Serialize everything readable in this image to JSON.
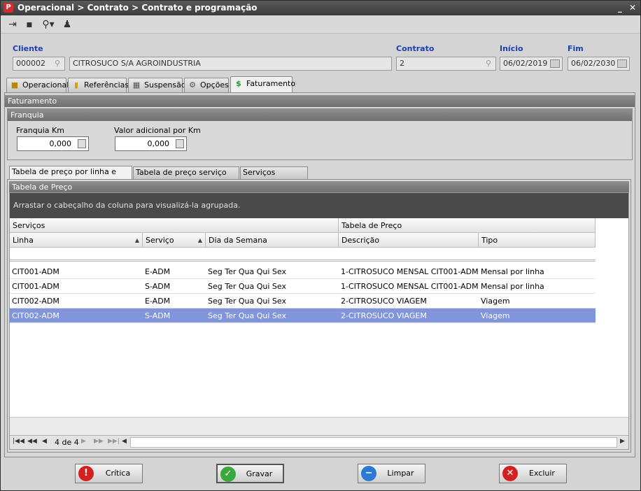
{
  "window": {
    "title": "Operacional > Contrato > Contrato e programação",
    "logo": "logo-icon"
  },
  "header": {
    "cliente_label": "Cliente",
    "cliente_code": "000002",
    "cliente_name": "CITROSUCO S/A AGROINDUSTRIA",
    "contrato_label": "Contrato",
    "contrato_value": "2",
    "inicio_label": "Início",
    "inicio_value": "06/02/2019",
    "fim_label": "Fim",
    "fim_value": "06/02/2030"
  },
  "tabs": [
    {
      "label": "Operacional",
      "icon": "truck-icon"
    },
    {
      "label": "Referências",
      "icon": "bookmark-icon"
    },
    {
      "label": "Suspensão",
      "icon": "calendar-icon"
    },
    {
      "label": "Opções",
      "icon": "gear-icon"
    },
    {
      "label": "Faturamento",
      "icon": "dollar-icon"
    }
  ],
  "faturamento": {
    "title": "Faturamento",
    "franquia_title": "Franquia",
    "franquia_km_label": "Franquia Km",
    "franquia_km_value": "0,000",
    "valor_adicional_label": "Valor adicional por Km",
    "valor_adicional_value": "0,000"
  },
  "subtabs": [
    "Tabela de preço por linha e serviço",
    "Tabela de preço serviço extra",
    "Serviços atrelados"
  ],
  "grid": {
    "title": "Tabela de Preço",
    "group_hint": "Arrastar o cabeçalho da coluna para visualizá-la agrupada.",
    "band_servicos": "Serviços",
    "band_tabela": "Tabela de Preço",
    "columns": [
      "Linha",
      "Serviço",
      "Dia da Semana",
      "Descrição",
      "Tipo"
    ],
    "rows": [
      [
        "CIT001-ADM",
        "E-ADM",
        "Seg Ter Qua Qui Sex",
        "1-CITROSUCO MENSAL CIT001-ADM",
        "Mensal por linha"
      ],
      [
        "CIT001-ADM",
        "S-ADM",
        "Seg Ter Qua Qui Sex",
        "1-CITROSUCO MENSAL CIT001-ADM",
        "Mensal por linha"
      ],
      [
        "CIT002-ADM",
        "E-ADM",
        "Seg Ter Qua Qui Sex",
        "2-CITROSUCO VIAGEM",
        "Viagem"
      ],
      [
        "CIT002-ADM",
        "S-ADM",
        "Seg Ter Qua Qui Sex",
        "2-CITROSUCO VIAGEM",
        "Viagem"
      ]
    ],
    "pager_text": "4 de 4"
  },
  "buttons": {
    "critica": "Crítica",
    "gravar": "Gravar",
    "limpar": "Limpar",
    "excluir": "Excluir"
  }
}
